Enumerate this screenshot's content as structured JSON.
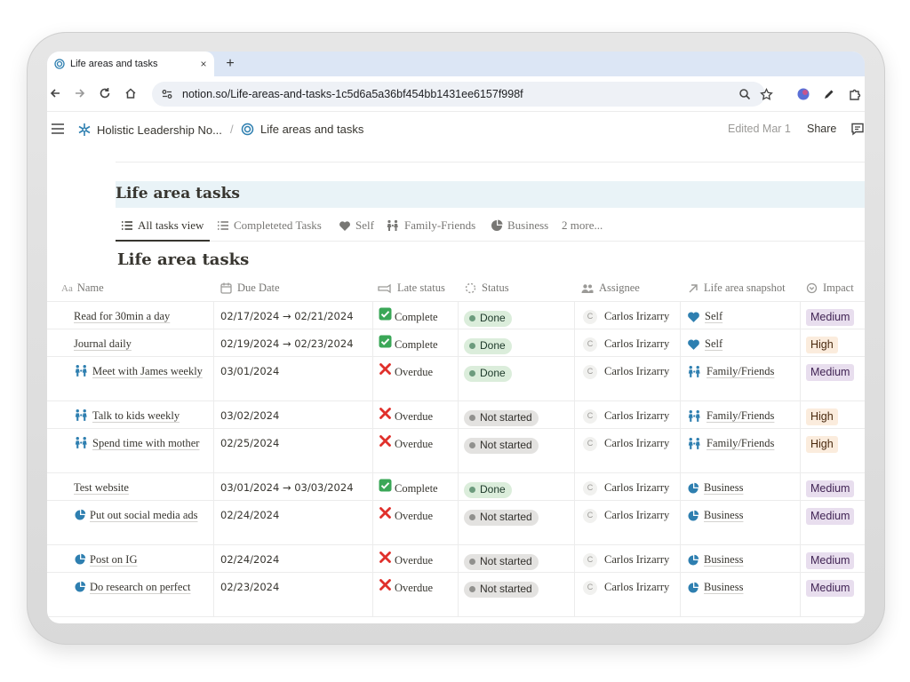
{
  "browser": {
    "tab_title": "Life areas and tasks",
    "tab_close": "×",
    "new_tab": "+",
    "url": "notion.so/Life-areas-and-tasks-1c5d6a5a36bf454bb1431ee6157f998f"
  },
  "topbar": {
    "breadcrumb_parent": "Holistic Leadership No...",
    "breadcrumb_sep": "/",
    "breadcrumb_current": "Life areas and tasks",
    "edited": "Edited Mar 1",
    "share": "Share"
  },
  "database": {
    "title": "Life area tasks",
    "views": [
      "All tasks view",
      "Completeted Tasks",
      "Self",
      "Family-Friends",
      "Business",
      "2 more..."
    ],
    "table_title": "Life area tasks",
    "columns": [
      "Name",
      "Due Date",
      "Late status",
      "Status",
      "Assignee",
      "Life area snapshot",
      "Impact"
    ],
    "rows": [
      {
        "name": "Read for 30min a day",
        "icon": "none",
        "date": "02/17/2024 → 02/21/2024",
        "late": "Complete",
        "late_icon": "check-icon",
        "status": "Done",
        "status_kind": "done",
        "assignee": "Carlos Irizarry",
        "initial": "C",
        "area": "Self",
        "area_icon": "heart-icon",
        "impact": "Medium",
        "impact_kind": "medium"
      },
      {
        "name": "Journal daily",
        "icon": "none",
        "date": "02/19/2024 → 02/23/2024",
        "late": "Complete",
        "late_icon": "check-icon",
        "status": "Done",
        "status_kind": "done",
        "assignee": "Carlos Irizarry",
        "initial": "C",
        "area": "Self",
        "area_icon": "heart-icon",
        "impact": "High",
        "impact_kind": "high"
      },
      {
        "name": "Meet with James weekly",
        "icon": "family-icon",
        "date": "03/01/2024",
        "late": "Overdue",
        "late_icon": "cross-icon",
        "status": "Done",
        "status_kind": "done",
        "assignee": "Carlos Irizarry",
        "initial": "C",
        "area": "Family/Friends",
        "area_icon": "family-icon",
        "impact": "Medium",
        "impact_kind": "medium"
      },
      {
        "name": "Talk to kids weekly",
        "icon": "family-icon",
        "date": "03/02/2024",
        "late": "Overdue",
        "late_icon": "cross-icon",
        "status": "Not started",
        "status_kind": "ns",
        "assignee": "Carlos Irizarry",
        "initial": "C",
        "area": "Family/Friends",
        "area_icon": "family-icon",
        "impact": "High",
        "impact_kind": "high"
      },
      {
        "name": "Spend time with mother",
        "icon": "family-icon",
        "date": "02/25/2024",
        "late": "Overdue",
        "late_icon": "cross-icon",
        "status": "Not started",
        "status_kind": "ns",
        "assignee": "Carlos Irizarry",
        "initial": "C",
        "area": "Family/Friends",
        "area_icon": "family-icon",
        "impact": "High",
        "impact_kind": "high"
      },
      {
        "name": "Test website",
        "icon": "none",
        "date": "03/01/2024 → 03/03/2024",
        "late": "Complete",
        "late_icon": "check-icon",
        "status": "Done",
        "status_kind": "done",
        "assignee": "Carlos Irizarry",
        "initial": "C",
        "area": "Business",
        "area_icon": "business-icon",
        "impact": "Medium",
        "impact_kind": "medium"
      },
      {
        "name": "Put out social media ads",
        "icon": "business-icon",
        "date": "02/24/2024",
        "late": "Overdue",
        "late_icon": "cross-icon",
        "status": "Not started",
        "status_kind": "ns",
        "assignee": "Carlos Irizarry",
        "initial": "C",
        "area": "Business",
        "area_icon": "business-icon",
        "impact": "Medium",
        "impact_kind": "medium"
      },
      {
        "name": "Post on IG",
        "icon": "business-icon",
        "date": "02/24/2024",
        "late": "Overdue",
        "late_icon": "cross-icon",
        "status": "Not started",
        "status_kind": "ns",
        "assignee": "Carlos Irizarry",
        "initial": "C",
        "area": "Business",
        "area_icon": "business-icon",
        "impact": "Medium",
        "impact_kind": "medium"
      },
      {
        "name": "Do research on perfect",
        "icon": "business-icon",
        "date": "02/23/2024",
        "late": "Overdue",
        "late_icon": "cross-icon",
        "status": "Not started",
        "status_kind": "ns",
        "assignee": "Carlos Irizarry",
        "initial": "C",
        "area": "Business",
        "area_icon": "business-icon",
        "impact": "Medium",
        "impact_kind": "medium"
      }
    ]
  },
  "colors": {
    "accent_blue": "#2e7fb0",
    "done_bg": "#dbeddb",
    "not_started_bg": "#e3e2e0",
    "medium_bg": "#e8deee",
    "high_bg": "#fbecdd"
  }
}
